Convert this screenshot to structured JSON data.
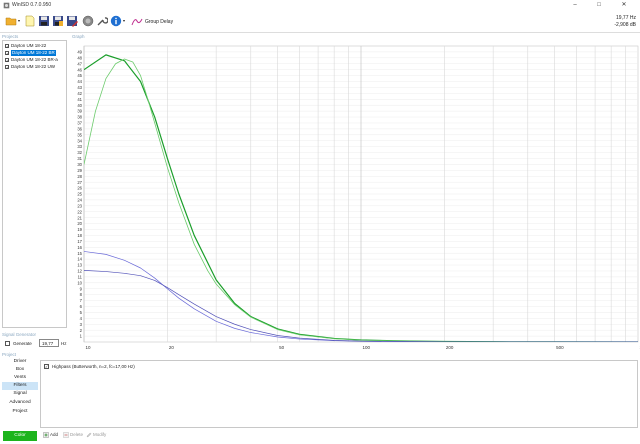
{
  "window": {
    "title": "WinISD 0.7.0.950",
    "controls": [
      "minimize-icon",
      "maximize-icon",
      "close-icon"
    ]
  },
  "toolbar": {
    "icons": [
      "open-folder-icon",
      "new-file-icon",
      "save-icon",
      "save-all-icon",
      "save-as-icon",
      "driver-editor-icon",
      "wrench-icon",
      "info-icon",
      "group-delay-icon"
    ],
    "group_delay_label": "Group Delay"
  },
  "readout": {
    "frequency": "19,77 Hz",
    "level": "-2,908 dB"
  },
  "sections": {
    "projects": "Projects",
    "graph": "Graph",
    "signal_generator": "Signal Generator",
    "project": "Project"
  },
  "projects": [
    {
      "label": "Dayton UM 18-22",
      "checked": true,
      "selected": false
    },
    {
      "label": "Dayton UM 18-22 BR",
      "checked": true,
      "selected": true
    },
    {
      "label": "Dayton UM 18-22 BR-a",
      "checked": true,
      "selected": false
    },
    {
      "label": "Dayton UM 18-22 UW",
      "checked": true,
      "selected": false
    }
  ],
  "signal_generator": {
    "generate_label": "Generate",
    "generate_checked": false,
    "frequency_value": "19,77",
    "unit": "Hz"
  },
  "project_nav": [
    {
      "label": "Driver",
      "active": false
    },
    {
      "label": "Box",
      "active": false
    },
    {
      "label": "Vents",
      "active": false
    },
    {
      "label": "Filters",
      "active": true
    },
    {
      "label": "Signal",
      "active": false
    },
    {
      "label": "Advanced",
      "active": false
    },
    {
      "label": "Project",
      "active": false
    }
  ],
  "filters": [
    {
      "label": "Highpass (Butterworth, n=2, fc=17,00 Hz)",
      "checked": true
    }
  ],
  "bottom_bar": {
    "color_label": "Color",
    "add_label": "Add",
    "delete_label": "Delete",
    "modify_label": "Modify"
  },
  "colors": {
    "selection": "#0078d7",
    "nav_active": "#cce4f7",
    "color_button": "#1db41d",
    "section_label": "#8aa7c0",
    "series_dark_green": "#1a9e2a",
    "series_light_green": "#6ccb6c",
    "series_blue_a": "#6a6ad8",
    "series_blue_b": "#5252b8"
  },
  "chart_data": {
    "type": "line",
    "title": "",
    "xlabel": "",
    "ylabel": "",
    "x_scale": "log",
    "xlim": [
      10,
      1000
    ],
    "ylim": [
      0,
      50
    ],
    "grid": true,
    "x_tick_labels": [
      {
        "value": 10,
        "label": "10"
      },
      {
        "value": 20,
        "label": "20"
      },
      {
        "value": 50,
        "label": "50"
      },
      {
        "value": 100,
        "label": "100"
      },
      {
        "value": 200,
        "label": "200"
      },
      {
        "value": 500,
        "label": "500"
      },
      {
        "value": 1000,
        "label": "1k"
      }
    ],
    "y_ticks": [
      1,
      2,
      3,
      4,
      5,
      6,
      7,
      8,
      9,
      10,
      11,
      12,
      13,
      14,
      15,
      16,
      17,
      18,
      19,
      20,
      21,
      22,
      23,
      24,
      25,
      26,
      27,
      28,
      29,
      30,
      31,
      32,
      33,
      34,
      35,
      36,
      37,
      38,
      39,
      40,
      41,
      42,
      43,
      44,
      45,
      46,
      47,
      48,
      49
    ],
    "series": [
      {
        "color": "#1a9e2a",
        "width": 1.2,
        "x": [
          10,
          12,
          14,
          16,
          18,
          20,
          22,
          25,
          30,
          35,
          40,
          50,
          60,
          80,
          100,
          150,
          200,
          300,
          500,
          1000
        ],
        "y": [
          46,
          48.5,
          47.5,
          44,
          38,
          31,
          25,
          18,
          10.5,
          6.5,
          4.3,
          2.2,
          1.3,
          0.6,
          0.35,
          0.15,
          0.08,
          0.04,
          0.02,
          0.01
        ]
      },
      {
        "color": "#6ccb6c",
        "width": 0.8,
        "x": [
          10,
          11,
          12,
          13,
          14,
          15,
          16,
          17,
          18,
          20,
          22,
          25,
          28,
          30,
          35,
          40,
          50,
          60,
          80,
          100,
          150,
          200,
          300,
          500,
          1000
        ],
        "y": [
          30,
          39,
          44.5,
          47,
          47.8,
          47.3,
          45,
          41,
          37,
          29.5,
          23.5,
          16.5,
          12,
          9.8,
          6.3,
          4.2,
          2.1,
          1.2,
          0.55,
          0.3,
          0.12,
          0.06,
          0.03,
          0.01,
          0.005
        ]
      },
      {
        "color": "#6a6ad8",
        "width": 0.7,
        "x": [
          10,
          12,
          14,
          16,
          18,
          20,
          22,
          25,
          30,
          35,
          40,
          50,
          60,
          80,
          100,
          150,
          200,
          300,
          500,
          1000
        ],
        "y": [
          15.3,
          14.8,
          13.8,
          12.5,
          10.8,
          9.0,
          7.4,
          5.6,
          3.5,
          2.3,
          1.6,
          0.85,
          0.5,
          0.22,
          0.12,
          0.05,
          0.025,
          0.01,
          0.005,
          0.002
        ]
      },
      {
        "color": "#5252b8",
        "width": 0.7,
        "x": [
          10,
          12,
          14,
          16,
          18,
          20,
          22,
          25,
          30,
          35,
          40,
          50,
          60,
          80,
          100,
          150,
          200,
          300,
          500,
          1000
        ],
        "y": [
          12.1,
          11.9,
          11.6,
          11.2,
          10.4,
          9.2,
          8.0,
          6.4,
          4.3,
          3.0,
          2.1,
          1.1,
          0.65,
          0.28,
          0.15,
          0.06,
          0.03,
          0.012,
          0.005,
          0.002
        ]
      }
    ]
  }
}
